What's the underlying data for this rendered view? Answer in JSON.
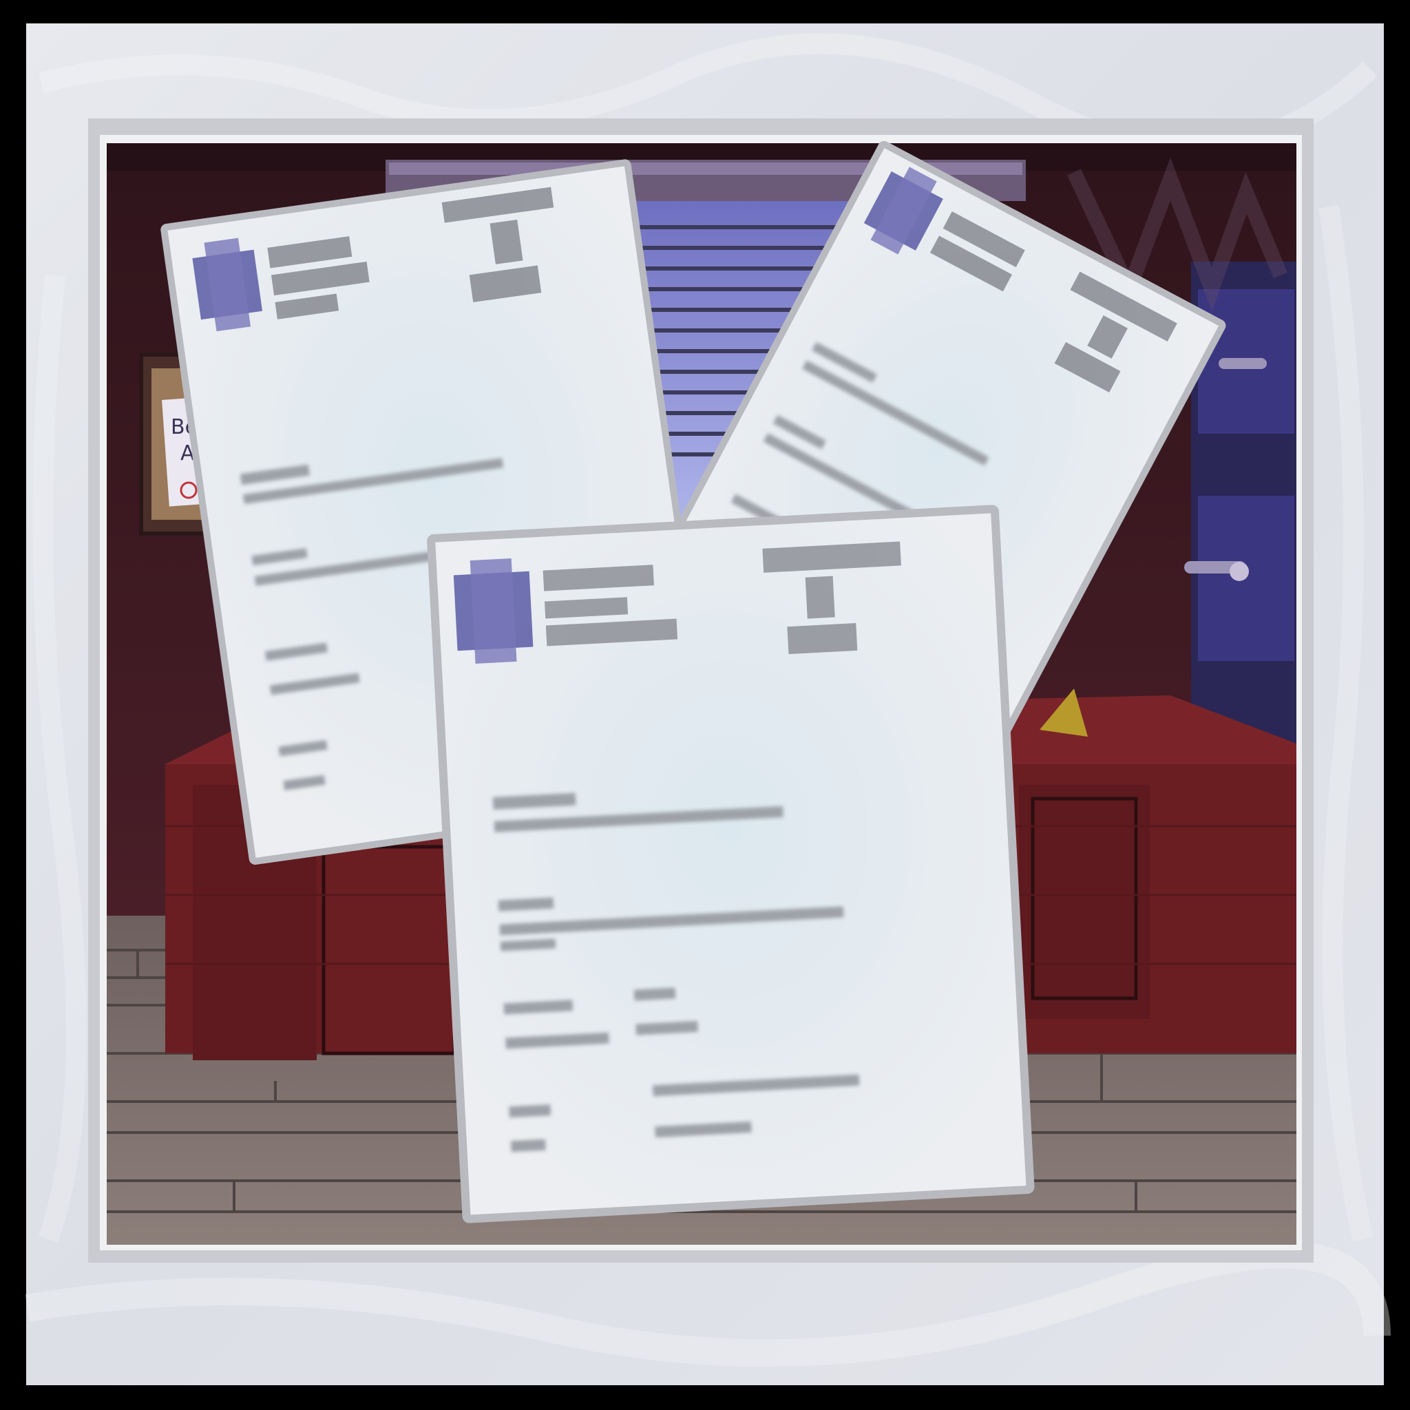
{
  "scene": {
    "memo_sign": {
      "line1": "Be",
      "line2": "A"
    },
    "documents": [
      {
        "id": "left-document",
        "state": "redacted"
      },
      {
        "id": "right-document",
        "state": "redacted"
      },
      {
        "id": "front-document",
        "state": "redacted"
      }
    ],
    "colors": {
      "outer_frame": "#000000",
      "paper_background": "#e4e6ea",
      "photo_border": "#c7c9ce",
      "wall": "#3c1a22",
      "desk": "#6a1e22",
      "floor": "#7a6e6c",
      "window_glass": "#8c94d6",
      "logo": "#5b5aa6",
      "document_paper": "#e9ecef"
    }
  }
}
